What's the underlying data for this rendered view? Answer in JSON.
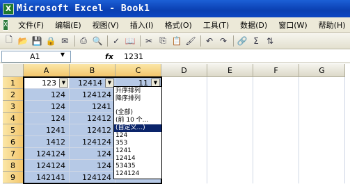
{
  "titlebar": {
    "title": "Microsoft Excel - Book1",
    "icon": "X"
  },
  "menubar": {
    "icon": "X",
    "items": [
      "文件(F)",
      "编辑(E)",
      "视图(V)",
      "插入(I)",
      "格式(O)",
      "工具(T)",
      "数据(D)",
      "窗口(W)",
      "帮助(H)"
    ]
  },
  "toolbar": {
    "buttons": [
      "new-icon",
      "open-icon",
      "save-icon",
      "permission-icon",
      "email-icon",
      "print-icon",
      "print-preview-icon",
      "spelling-icon",
      "research-icon",
      "cut-icon",
      "copy-icon",
      "paste-icon",
      "format-painter-icon",
      "undo-icon",
      "redo-icon",
      "hyperlink-icon",
      "autosum-icon",
      "sort-ascending-icon"
    ]
  },
  "formula": {
    "name_box": "A1",
    "fx": "fx",
    "value": "1231"
  },
  "columns": [
    "A",
    "B",
    "C",
    "D",
    "E",
    "F",
    "G"
  ],
  "rows": [
    "1",
    "2",
    "3",
    "4",
    "5",
    "6",
    "7",
    "8",
    "9"
  ],
  "cells": {
    "A": [
      "123",
      "124",
      "124",
      "124",
      "1241",
      "1412",
      "124124",
      "124124",
      "142141"
    ],
    "B": [
      "12414",
      "124124",
      "1241",
      "12412",
      "12412",
      "124124",
      "124",
      "124",
      "124124"
    ],
    "C": [
      "11",
      "",
      "",
      "",
      "",
      "",
      "",
      "",
      ""
    ]
  },
  "dropdown": {
    "items": [
      "升序排列",
      "降序排列",
      "",
      "(全部)",
      "(前 10 个...",
      "(自定义...)",
      "124",
      "353",
      "1241",
      "12414",
      "53435",
      "124124"
    ],
    "highlighted_index": 5
  }
}
